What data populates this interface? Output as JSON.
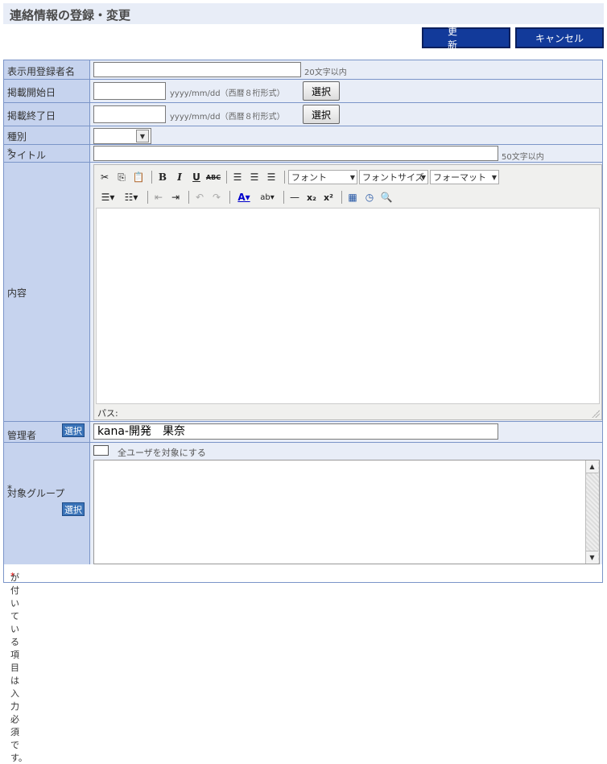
{
  "page": {
    "title": "連絡情報の登録・変更"
  },
  "actions": {
    "update_label": "更 新",
    "cancel_label": "キャンセル"
  },
  "fields": {
    "display_name": {
      "label": "表示用登録者名",
      "value": "",
      "hint": "20文字以内"
    },
    "start_date": {
      "label": "掲載開始日",
      "value": "",
      "hint": "yyyy/mm/dd（西暦８桁形式）",
      "button": "選択"
    },
    "end_date": {
      "label": "掲載終了日",
      "value": "",
      "hint": "yyyy/mm/dd（西暦８桁形式）",
      "button": "選択"
    },
    "type": {
      "label": "種別",
      "value": ""
    },
    "title": {
      "label": "タイトル",
      "value": "",
      "hint": "50文字以内",
      "required_mark": "*"
    },
    "content": {
      "label": "内容"
    },
    "manager": {
      "label": "管理者",
      "button": "選択",
      "value": "kana-開発　果奈"
    },
    "target_group": {
      "label": "対象グループ",
      "required_mark": "*",
      "button": "選択",
      "all_users_label": "全ユーザを対象にする"
    }
  },
  "editor": {
    "font_label": "フォント",
    "font_size_label": "フォントサイズ",
    "format_label": "フォーマット",
    "path_label": "パス:",
    "toolbar1_icons": [
      "cut-icon",
      "copy-icon",
      "paste-icon",
      "bold-icon",
      "italic-icon",
      "underline-icon",
      "strikethrough-icon",
      "align-left-icon",
      "align-center-icon",
      "align-right-icon"
    ],
    "toolbar2_icons": [
      "bullet-list-icon",
      "numbered-list-icon",
      "outdent-icon",
      "indent-icon",
      "undo-icon",
      "redo-icon",
      "text-color-icon",
      "highlight-icon",
      "horizontal-rule-icon",
      "subscript-icon",
      "superscript-icon",
      "insert-date-icon",
      "insert-time-icon",
      "preview-icon"
    ]
  },
  "footer": {
    "required_mark": "*",
    "note": " が付いている項目は入力必須です。"
  },
  "colors": {
    "header_bg": "#e8edf7",
    "label_bg": "#c6d3ee",
    "border": "#7b95c8",
    "button_blue": "#123a9a",
    "required": "#e00000"
  }
}
